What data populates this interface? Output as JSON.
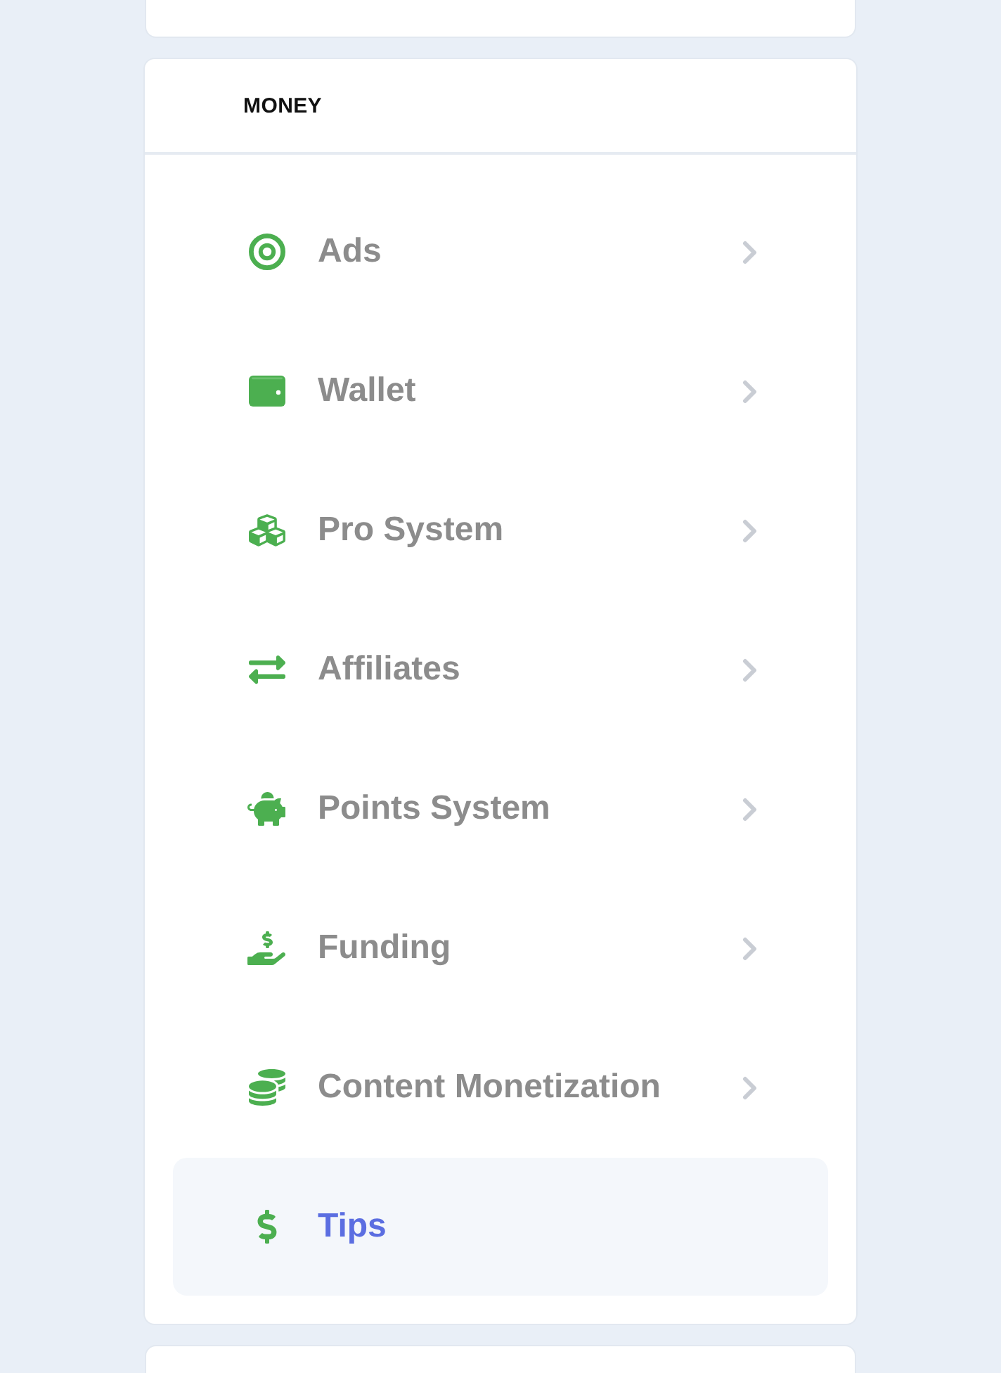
{
  "section": {
    "title": "MONEY",
    "items": [
      {
        "label": "Ads",
        "selected": false,
        "expandable": true
      },
      {
        "label": "Wallet",
        "selected": false,
        "expandable": true
      },
      {
        "label": "Pro System",
        "selected": false,
        "expandable": true
      },
      {
        "label": "Affiliates",
        "selected": false,
        "expandable": true
      },
      {
        "label": "Points System",
        "selected": false,
        "expandable": true
      },
      {
        "label": "Funding",
        "selected": false,
        "expandable": true
      },
      {
        "label": "Content Monetization",
        "selected": false,
        "expandable": true
      },
      {
        "label": "Tips",
        "selected": true,
        "expandable": false
      }
    ]
  }
}
